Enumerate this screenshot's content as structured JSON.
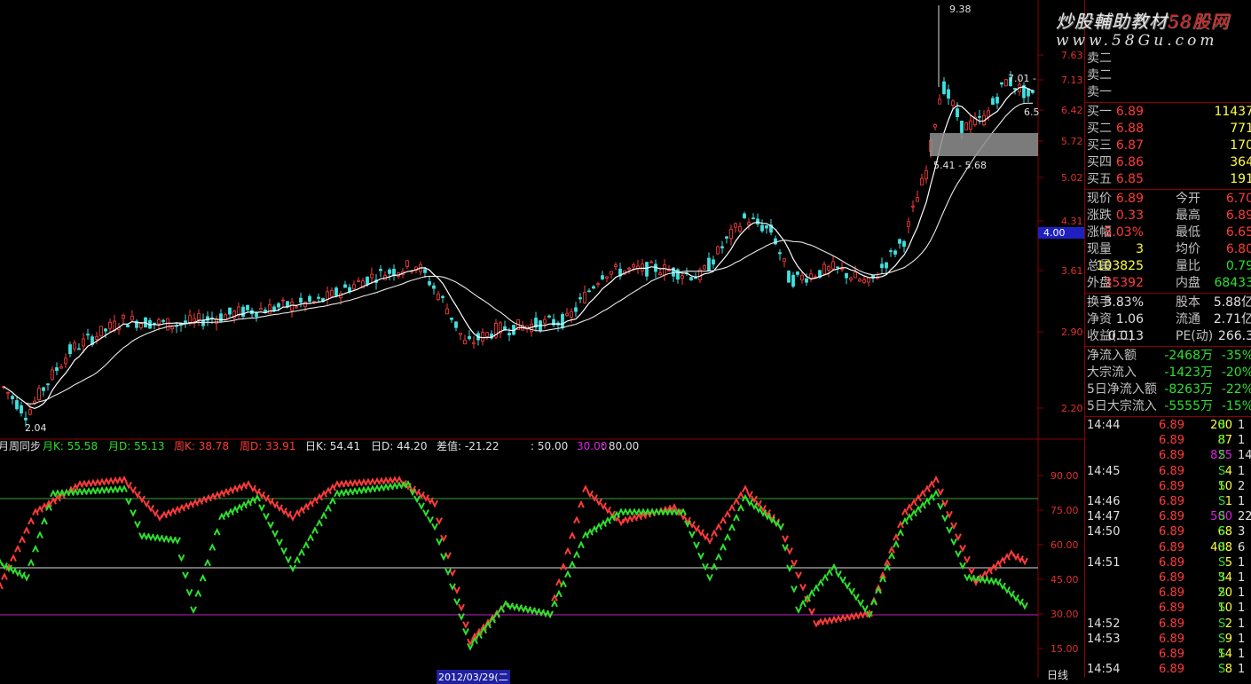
{
  "brand": {
    "title_a": "炒股輔助教材",
    "title_b": "58股网",
    "url": "www.58Gu.com"
  },
  "price_axis": [
    "7.63",
    "7.13",
    "6.42",
    "5.72",
    "5.02",
    "4.31",
    "3.61",
    "2.90",
    "2.20"
  ],
  "price_highlight": "4.00",
  "price_notes": {
    "low": "2.04",
    "high": "9.38",
    "range_box": "5.41 - 5.68",
    "near_top": "7.01 -",
    "right_mid": "6.5"
  },
  "indicator": {
    "name": "月周同步",
    "items": [
      {
        "label": "月K:",
        "value": "55.58",
        "color": "#2ee02e"
      },
      {
        "label": "月D:",
        "value": "55.13",
        "color": "#2ee02e"
      },
      {
        "label": "周K:",
        "value": "38.78",
        "color": "#ff3b3b"
      },
      {
        "label": "周D:",
        "value": "33.91",
        "color": "#ff3b3b"
      },
      {
        "label": "日K:",
        "value": "54.41",
        "color": "#e0e0e0"
      },
      {
        "label": "日D:",
        "value": "44.20",
        "color": "#e0e0e0"
      },
      {
        "label": "差值:",
        "value": "-21.22",
        "color": "#e0e0e0"
      }
    ],
    "levels_text": [
      ": 50.00",
      "30.00",
      ": 80.00"
    ],
    "axis": [
      "90.00",
      "75.00",
      "60.00",
      "45.00",
      "30.00",
      "15.00"
    ]
  },
  "date_label": "2012/03/29(二",
  "period_label": "日线",
  "order_book": {
    "sells": [
      {
        "label": "卖二"
      },
      {
        "label": "卖二"
      },
      {
        "label": "卖一"
      }
    ],
    "buys": [
      {
        "label": "买一",
        "price": "6.89",
        "vol": "11437"
      },
      {
        "label": "买二",
        "price": "6.88",
        "vol": "771"
      },
      {
        "label": "买三",
        "price": "6.87",
        "vol": "170"
      },
      {
        "label": "买四",
        "price": "6.86",
        "vol": "364"
      },
      {
        "label": "买五",
        "price": "6.85",
        "vol": "191"
      }
    ]
  },
  "stats": [
    {
      "l1": "现价",
      "v1": "6.89",
      "c1": "red",
      "l2": "今开",
      "v2": "6.70",
      "c2": "red"
    },
    {
      "l1": "涨跌",
      "v1": "0.33",
      "c1": "red",
      "l2": "最高",
      "v2": "6.89",
      "c2": "red"
    },
    {
      "l1": "涨幅",
      "v1": "5.03%",
      "c1": "red",
      "l2": "最低",
      "v2": "6.65",
      "c2": "red"
    },
    {
      "l1": "现量",
      "v1": "3",
      "c1": "yel",
      "l2": "均价",
      "v2": "6.80",
      "c2": "red"
    },
    {
      "l1": "总量",
      "v1": "103825",
      "c1": "yel",
      "l2": "量比",
      "v2": "0.79",
      "c2": "grn"
    },
    {
      "l1": "外盘",
      "v1": "35392",
      "c1": "red",
      "l2": "内盘",
      "v2": "68433",
      "c2": "grn"
    }
  ],
  "fundamentals": [
    {
      "l1": "换手",
      "v1": "3.83%",
      "l2": "股本",
      "v2": "5.88亿"
    },
    {
      "l1": "净资",
      "v1": "1.06",
      "l2": "流通",
      "v2": "2.71亿"
    },
    {
      "l1": "收益(二)",
      "v1": "0.013",
      "l2": "PE(动)",
      "v2": "266.3"
    }
  ],
  "flows": [
    {
      "label": "净流入额",
      "value": "-2468万",
      "pct": "-35%"
    },
    {
      "label": "大宗流入",
      "value": "-1423万",
      "pct": "-20%"
    },
    {
      "label": "5日净流入额",
      "value": "-8263万",
      "pct": "-22%"
    },
    {
      "label": "5日大宗流入",
      "value": "-5555万",
      "pct": "-15%"
    }
  ],
  "ticks": [
    {
      "time": "14:44",
      "price": "6.89",
      "vol": "200",
      "side": "S",
      "n": "1"
    },
    {
      "time": "",
      "price": "6.89",
      "vol": "87",
      "side": "S",
      "n": "1"
    },
    {
      "time": "",
      "price": "6.89",
      "vol": "825",
      "side": "S",
      "n": "14",
      "big": true
    },
    {
      "time": "14:45",
      "price": "6.89",
      "vol": "4",
      "side": "S",
      "n": "1"
    },
    {
      "time": "",
      "price": "6.89",
      "vol": "10",
      "side": "S",
      "n": "2"
    },
    {
      "time": "14:46",
      "price": "6.89",
      "vol": "1",
      "side": "S",
      "n": "1"
    },
    {
      "time": "14:47",
      "price": "6.89",
      "vol": "500",
      "side": "S",
      "n": "22",
      "big": true
    },
    {
      "time": "14:50",
      "price": "6.89",
      "vol": "68",
      "side": "S",
      "n": "3"
    },
    {
      "time": "",
      "price": "6.89",
      "vol": "408",
      "side": "S",
      "n": "6"
    },
    {
      "time": "14:51",
      "price": "6.89",
      "vol": "5",
      "side": "S",
      "n": "1"
    },
    {
      "time": "",
      "price": "6.89",
      "vol": "34",
      "side": "S",
      "n": "1"
    },
    {
      "time": "",
      "price": "6.89",
      "vol": "20",
      "side": "S",
      "n": "1"
    },
    {
      "time": "",
      "price": "6.89",
      "vol": "10",
      "side": "S",
      "n": "1"
    },
    {
      "time": "14:52",
      "price": "6.89",
      "vol": "2",
      "side": "S",
      "n": "1"
    },
    {
      "time": "14:53",
      "price": "6.89",
      "vol": "9",
      "side": "S",
      "n": "1"
    },
    {
      "time": "",
      "price": "6.89",
      "vol": "14",
      "side": "S",
      "n": "1"
    },
    {
      "time": "14:54",
      "price": "6.89",
      "vol": "8",
      "side": "S",
      "n": "1"
    }
  ],
  "colors": {
    "up": "#ff3b3b",
    "down": "#2ee02e",
    "grid": "#8b0000",
    "ma": "#e0e0e0"
  }
}
